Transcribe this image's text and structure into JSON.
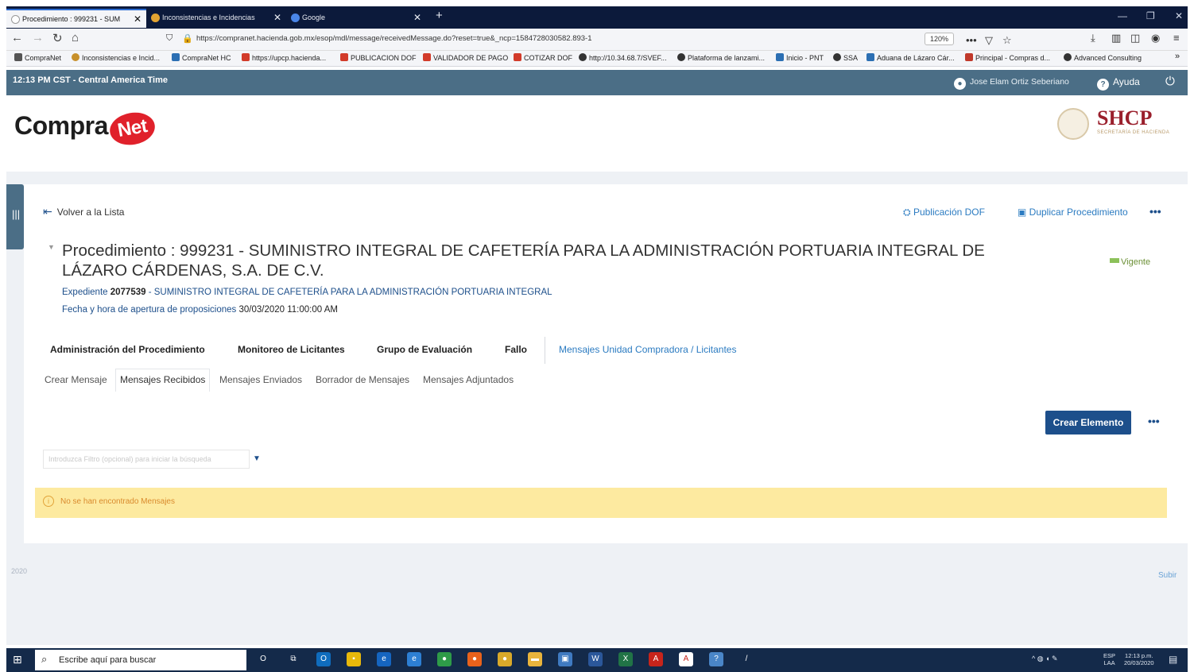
{
  "browser": {
    "tabs": [
      {
        "label": "Procedimiento : 999231 - SUM",
        "active": true,
        "favicon_color": "#ffffff"
      },
      {
        "label": "Inconsistencias e Incidencias",
        "active": false,
        "favicon_color": "#e3a432"
      },
      {
        "label": "Google",
        "active": false,
        "favicon_color": "#4a86e8"
      }
    ],
    "tab_close": "✕",
    "new_tab": "+",
    "url": "https://compranet.hacienda.gob.mx/esop/mdl/message/receivedMessage.do?reset=true&_ncp=1584728030582.893-1",
    "zoom": "120%",
    "bookmarks": [
      {
        "label": "CompraNet",
        "color": "#555555"
      },
      {
        "label": "Inconsistencias e Incid...",
        "color": "#c7902a"
      },
      {
        "label": "CompraNet HC",
        "color": "#2c6fb3"
      },
      {
        "label": "https://upcp.hacienda...",
        "color": "#d23b2a"
      },
      {
        "label": "PUBLICACION DOF",
        "color": "#d23b2a"
      },
      {
        "label": "VALIDADOR DE PAGO",
        "color": "#d23b2a"
      },
      {
        "label": "COTIZAR DOF",
        "color": "#d23b2a"
      },
      {
        "label": "http://10.34.68.7/SVEF...",
        "color": "#333333"
      },
      {
        "label": "Plataforma de lanzami...",
        "color": "#333333"
      },
      {
        "label": "Inicio - PNT",
        "color": "#2c6fb3"
      },
      {
        "label": "SSA",
        "color": "#333333"
      },
      {
        "label": "Aduana de Lázaro Cár...",
        "color": "#2c6fb3"
      },
      {
        "label": "Principal - Compras d...",
        "color": "#c0392b"
      },
      {
        "label": "Advanced Consulting",
        "color": "#333333"
      }
    ]
  },
  "header": {
    "timezone": "12:13 PM CST - Central America Time",
    "user": "Jose Elam Ortiz Seberiano",
    "help": "Ayuda",
    "logo_text": "Compra",
    "logo_badge": "Net",
    "agency": "SHCP",
    "agency_sub": "SECRETARÍA DE HACIENDA"
  },
  "page": {
    "back_label": "Volver a la Lista",
    "pub_dof": "Publicación DOF",
    "duplicar": "Duplicar Procedimiento",
    "more": "•••",
    "title": "Procedimiento : 999231 - SUMINISTRO INTEGRAL DE CAFETERÍA PARA LA ADMINISTRACIÓN PORTUARIA INTEGRAL DE LÁZARO CÁRDENAS, S.A. DE C.V.",
    "status": "Vigente",
    "status_color": "#8cc15a",
    "expediente_label": "Expediente",
    "expediente_num": "2077539",
    "expediente_desc": " - SUMINISTRO INTEGRAL DE CAFETERÍA PARA LA ADMINISTRACIÓN PORTUARIA INTEGRAL",
    "fecha_label": "Fecha y hora de apertura de proposiciones",
    "fecha_value": "30/03/2020 11:00:00 AM",
    "tabs": [
      "Administración del Procedimiento",
      "Monitoreo de Licitantes",
      "Grupo de Evaluación",
      "Fallo",
      "Mensajes Unidad Compradora / Licitantes"
    ],
    "subtabs": [
      "Crear Mensaje",
      "Mensajes Recibidos",
      "Mensajes Enviados",
      "Borrador de Mensajes",
      "Mensajes Adjuntados"
    ],
    "create_button": "Crear Elemento",
    "filter_placeholder": "Introduzca Filtro (opcional) para iniciar la búsqueda",
    "alert": "No se han encontrado Mensajes",
    "footer_year": "2020",
    "subir": "Subir"
  },
  "taskbar": {
    "search": "Escribe aquí para buscar",
    "lang_top": "ESP",
    "lang_bottom": "LAA",
    "time": "12:13 p.m.",
    "date": "20/03/2020",
    "apps": [
      {
        "name": "cortana-icon",
        "glyph": "O",
        "color": "transparent"
      },
      {
        "name": "task-view-icon",
        "glyph": "⧉",
        "color": "transparent"
      },
      {
        "name": "outlook-icon",
        "glyph": "O",
        "color": "#0f6cbd"
      },
      {
        "name": "sticky-icon",
        "glyph": "▪",
        "color": "#e8b90b"
      },
      {
        "name": "edge-icon",
        "glyph": "e",
        "color": "#1565c0"
      },
      {
        "name": "ie-icon",
        "glyph": "e",
        "color": "#2d7fd3"
      },
      {
        "name": "chrome-icon",
        "glyph": "●",
        "color": "#2e9b48"
      },
      {
        "name": "firefox-icon",
        "glyph": "●",
        "color": "#e8621b"
      },
      {
        "name": "chat-icon",
        "glyph": "●",
        "color": "#d8a92a"
      },
      {
        "name": "explorer-icon",
        "glyph": "▬",
        "color": "#e9b43c"
      },
      {
        "name": "app-icon",
        "glyph": "▣",
        "color": "#3f7ac1"
      },
      {
        "name": "word-icon",
        "glyph": "W",
        "color": "#2b579a"
      },
      {
        "name": "excel-icon",
        "glyph": "X",
        "color": "#217346"
      },
      {
        "name": "acrobat-icon",
        "glyph": "A",
        "color": "#c7241b"
      },
      {
        "name": "pdf-icon",
        "glyph": "A",
        "color": "#ffffff"
      },
      {
        "name": "help-app-icon",
        "glyph": "?",
        "color": "#4a86c8"
      },
      {
        "name": "pen-icon",
        "glyph": "/",
        "color": "transparent"
      }
    ]
  }
}
